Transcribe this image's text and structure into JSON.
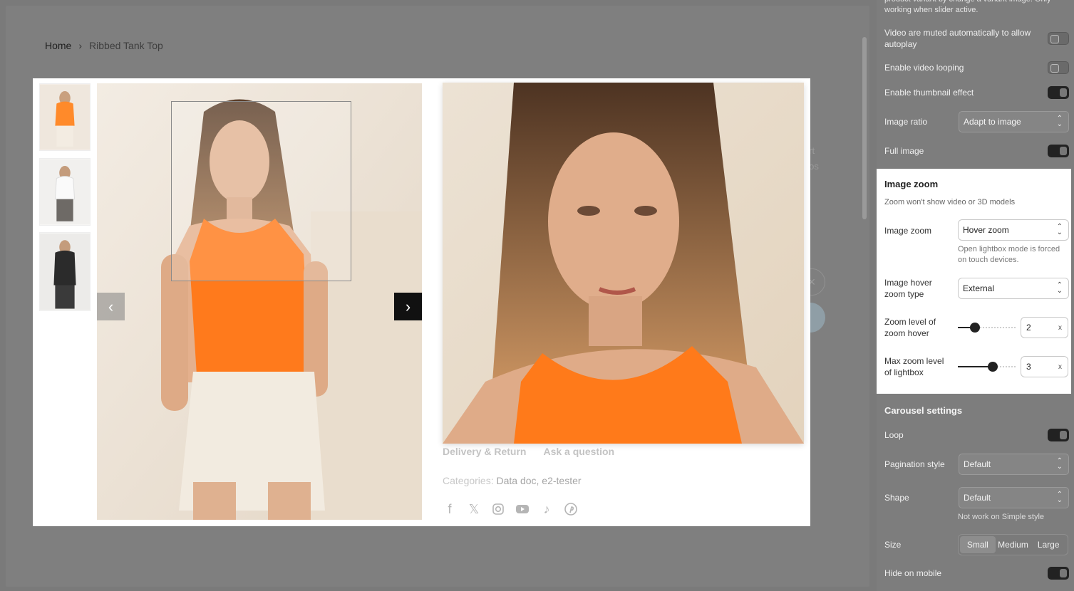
{
  "breadcrumb": {
    "home": "Home",
    "separator": "›",
    "current": "Ribbed Tank Top"
  },
  "modal": {
    "thumbnails": [
      "thumbnail-orange-top",
      "thumbnail-white-top",
      "thumbnail-black-top"
    ],
    "prev_icon": "‹",
    "next_icon": "›",
    "tabs": [
      "Delivery & Return",
      "Ask a question"
    ],
    "categories_label": "Categories:",
    "categories_value": "Data doc, e2-tester",
    "socials": [
      "facebook-icon",
      "x-icon",
      "instagram-icon",
      "youtube-icon",
      "tiktok-icon",
      "pinterest-icon"
    ]
  },
  "background_ghost": {
    "text1": "hirt",
    "text2": "alos",
    "close_icon": "×"
  },
  "panel": {
    "top_note": "product variant by change a variant image. Only working when slider active.",
    "video_muted_label": "Video are muted automatically to allow autoplay",
    "video_muted_on": false,
    "video_loop_label": "Enable video looping",
    "video_loop_on": false,
    "thumb_effect_label": "Enable thumbnail effect",
    "thumb_effect_on": true,
    "image_ratio_label": "Image ratio",
    "image_ratio_value": "Adapt to image",
    "full_image_label": "Full image",
    "full_image_on": true,
    "zoom": {
      "title": "Image zoom",
      "subtitle": "Zoom won't show video or 3D models",
      "image_zoom_label": "Image zoom",
      "image_zoom_value": "Hover zoom",
      "image_zoom_note": "Open lightbox mode is forced on touch devices.",
      "hover_type_label": "Image hover zoom type",
      "hover_type_value": "External",
      "zoom_level_label": "Zoom level of zoom hover",
      "zoom_level_value": "2",
      "zoom_level_fraction": 0.25,
      "max_zoom_label": "Max zoom level of lightbox",
      "max_zoom_value": "3",
      "max_zoom_fraction": 0.63,
      "unit": "x"
    },
    "carousel": {
      "title": "Carousel settings",
      "loop_label": "Loop",
      "loop_on": true,
      "pagination_label": "Pagination style",
      "pagination_value": "Default",
      "shape_label": "Shape",
      "shape_value": "Default",
      "shape_note": "Not work on Simple style",
      "size_label": "Size",
      "size_options": [
        "Small",
        "Medium",
        "Large"
      ],
      "size_selected": "Small",
      "hide_mobile_label": "Hide on mobile",
      "hide_mobile_on": true
    }
  }
}
